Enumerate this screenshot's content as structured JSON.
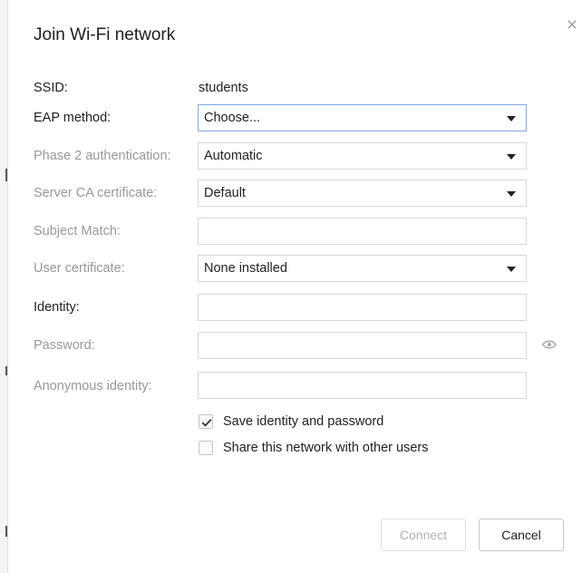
{
  "dialog": {
    "title": "Join Wi-Fi network",
    "close_icon": "close-icon"
  },
  "ssid": {
    "label": "SSID:",
    "value": "students"
  },
  "eap_method": {
    "label": "EAP method:",
    "value": "Choose..."
  },
  "phase2": {
    "label": "Phase 2 authentication:",
    "value": "Automatic"
  },
  "server_ca": {
    "label": "Server CA certificate:",
    "value": "Default"
  },
  "subject_match": {
    "label": "Subject Match:",
    "value": ""
  },
  "user_cert": {
    "label": "User certificate:",
    "value": "None installed"
  },
  "identity": {
    "label": "Identity:",
    "value": ""
  },
  "password": {
    "label": "Password:",
    "value": "",
    "reveal_icon": "eye-icon"
  },
  "anonymous_identity": {
    "label": "Anonymous identity:",
    "value": ""
  },
  "save_identity": {
    "label": "Save identity and password",
    "checked": true
  },
  "share_network": {
    "label": "Share this network with other users",
    "checked": false
  },
  "buttons": {
    "connect": "Connect",
    "cancel": "Cancel"
  },
  "colors": {
    "focus_border": "#7ea8e6",
    "disabled_label": "#999999",
    "text": "#222222"
  }
}
